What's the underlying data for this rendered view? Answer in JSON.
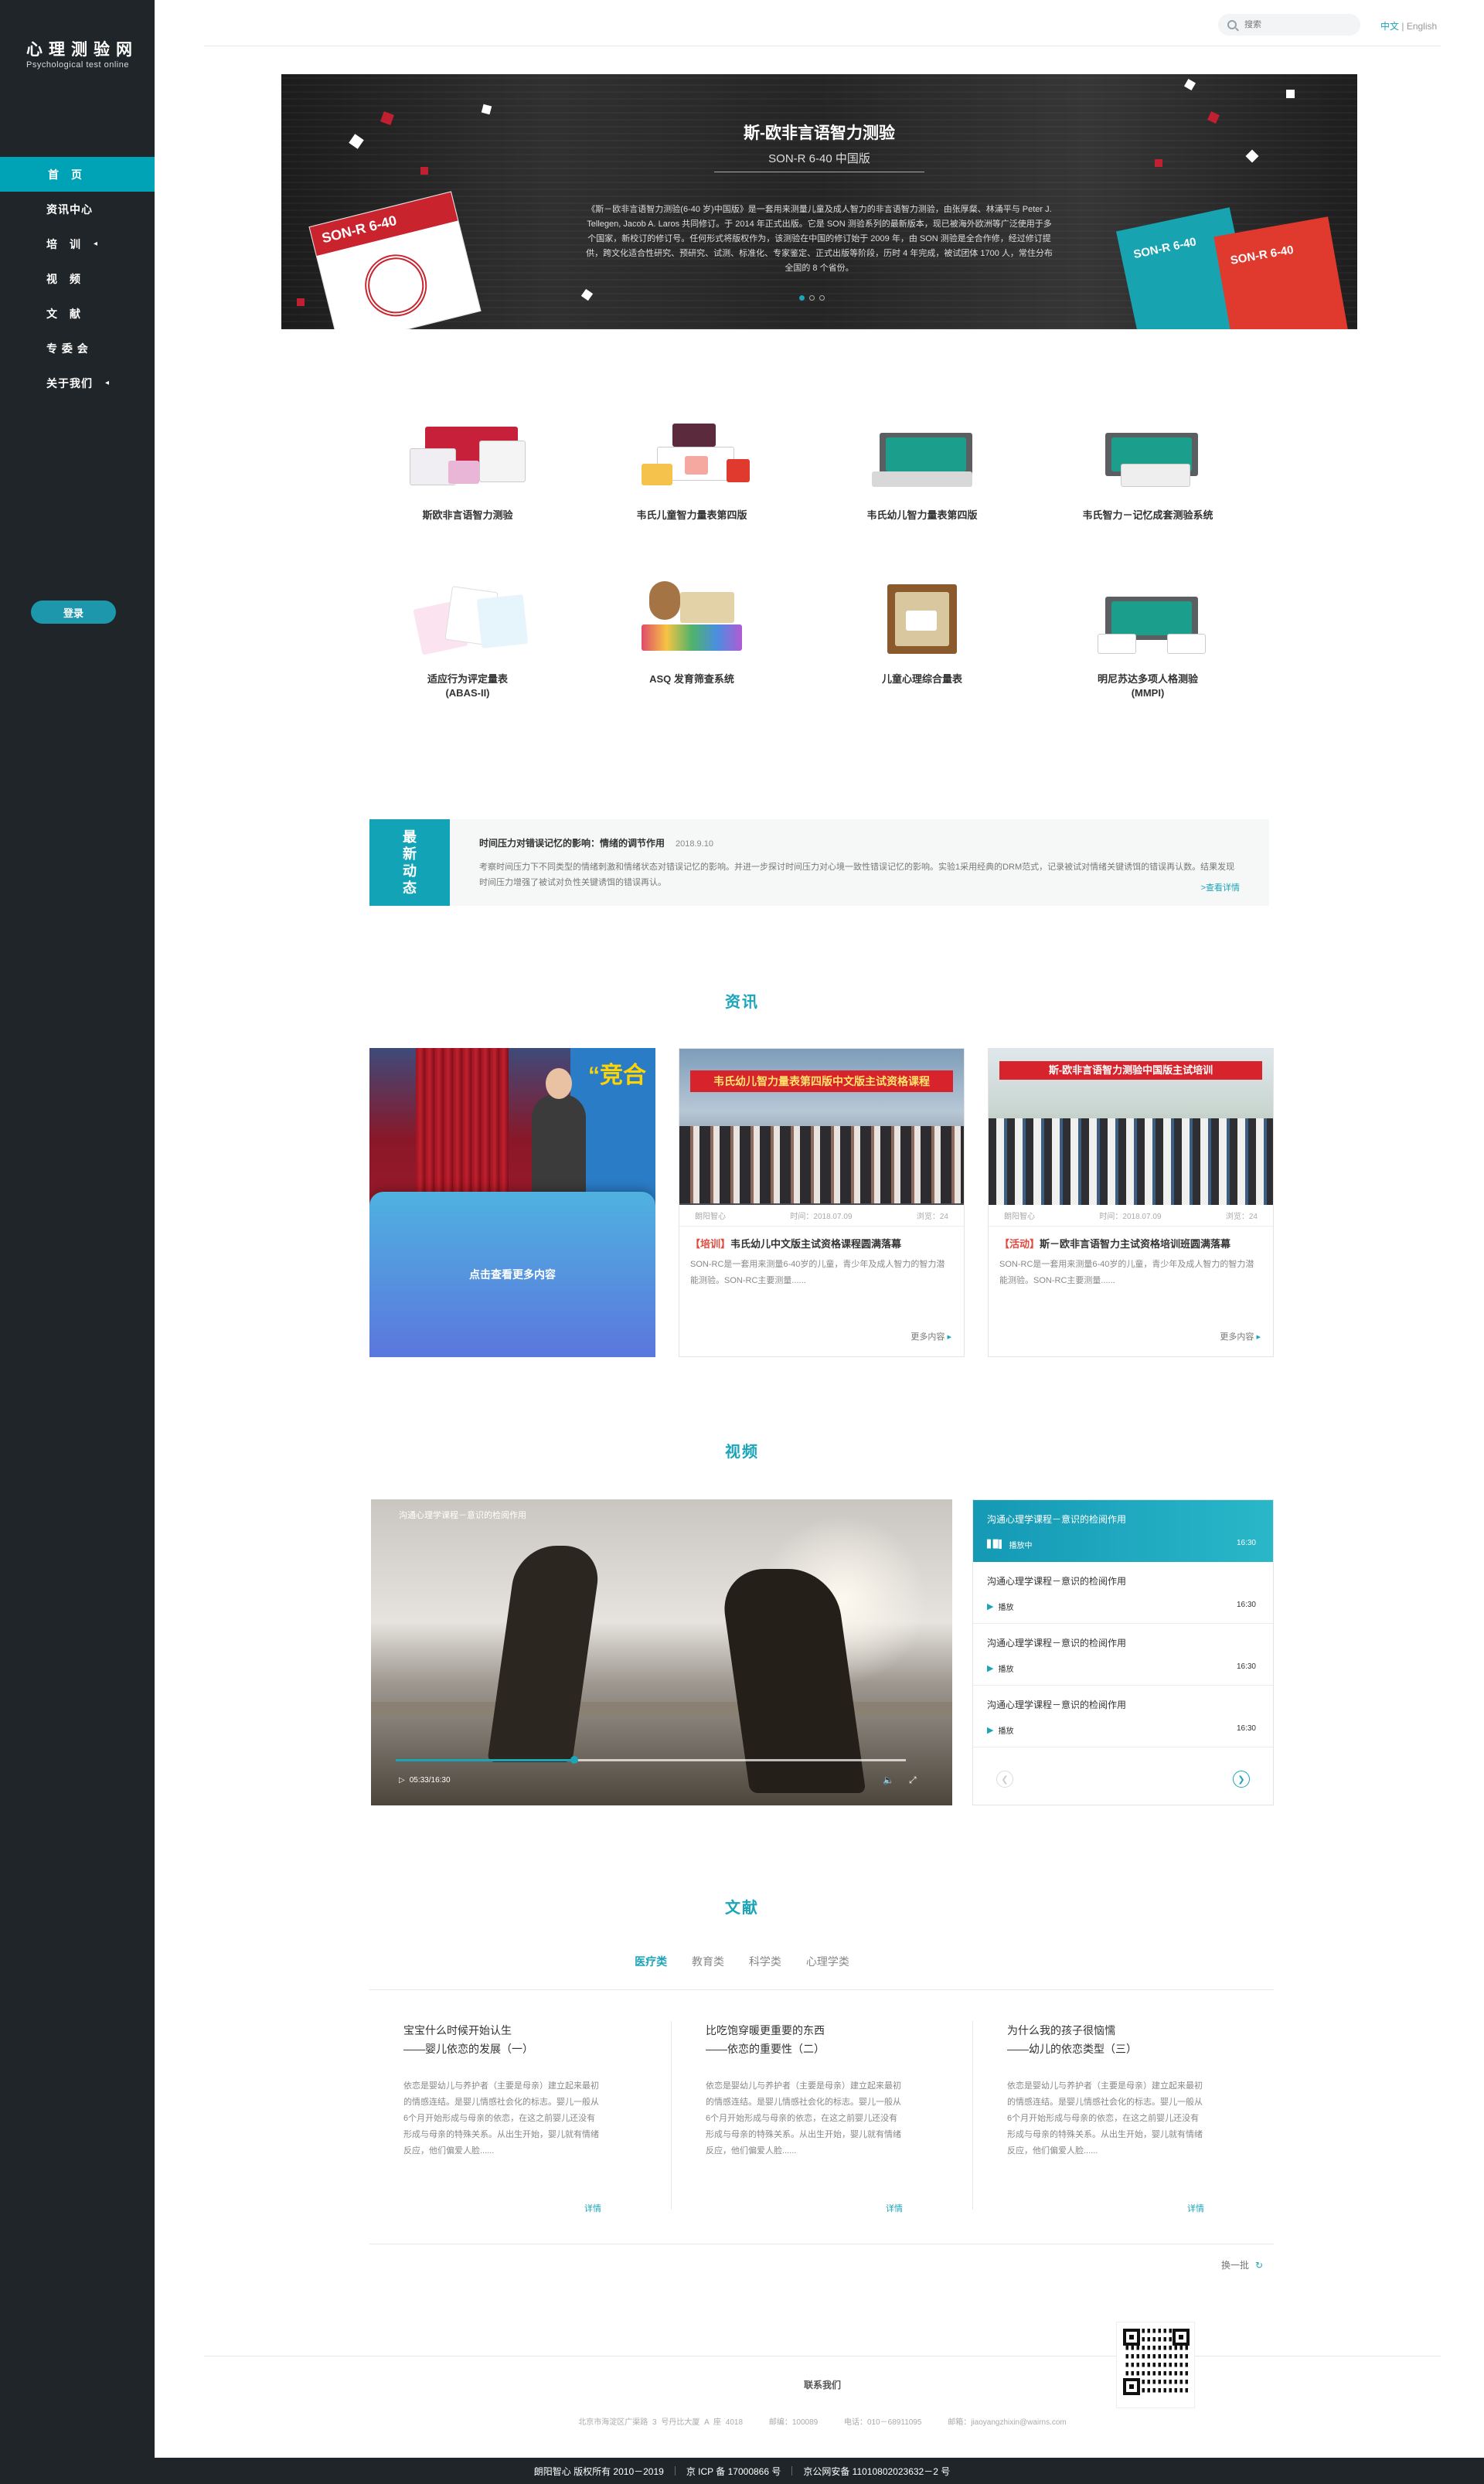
{
  "brand": {
    "title_cn": "心理测验网",
    "title_en": "Psychological test online"
  },
  "nav": {
    "items": [
      {
        "label": "首　页",
        "arrow": ""
      },
      {
        "label": "资讯中心",
        "arrow": ""
      },
      {
        "label": "培　训",
        "arrow": "◂"
      },
      {
        "label": "视　频",
        "arrow": ""
      },
      {
        "label": "文　献",
        "arrow": ""
      },
      {
        "label": "专 委 会",
        "arrow": ""
      },
      {
        "label": "关于我们",
        "arrow": "◂"
      }
    ],
    "login": "登录"
  },
  "header": {
    "search_placeholder": "搜索",
    "lang_cn": "中文",
    "lang_sep": " | ",
    "lang_en": "English"
  },
  "banner": {
    "title": "斯-欧非言语智力测验",
    "subtitle": "SON-R 6-40 中国版",
    "description": "《斯－欧非言语智力测验(6-40 岁)中国版》是一套用来测量儿童及成人智力的非言语智力测验，由张厚粲、林涌平与 Peter J. Tellegen, Jacob A. Laros 共同修订。于 2014 年正式出版。它是 SON 测验系列的最新版本，现已被海外欧洲等广泛使用于多个国家，新校订的修订号。任何形式将版权作为，该测验在中国的修订始于 2009 年，由 SON 测验是全合作修，经过修订提供，跨文化适合性研究、预研究、试测、标准化、专家鉴定、正式出版等阶段，历时 4 年完成，被试团体 1700 人，常住分布全国的 8 个省份。",
    "book_left": "SON-R 6-40",
    "book_right_1": "SON-R 6-40",
    "book_right_2": "SON-R 6-40"
  },
  "products": [
    {
      "name": "斯欧非言语智力测验",
      "name2": ""
    },
    {
      "name": "韦氏儿童智力量表第四版",
      "name2": ""
    },
    {
      "name": "韦氏幼儿智力量表第四版",
      "name2": ""
    },
    {
      "name": "韦氏智力－记忆成套测验系统",
      "name2": ""
    },
    {
      "name": "适应行为评定量表",
      "name2": "(ABAS-II)"
    },
    {
      "name": "ASQ 发育筛查系统",
      "name2": ""
    },
    {
      "name": "儿童心理综合量表",
      "name2": ""
    },
    {
      "name": "明尼苏达多项人格测验",
      "name2": "(MMPI)"
    }
  ],
  "latest": {
    "tag": [
      "最",
      "新",
      "动",
      "态"
    ],
    "title": "时间压力对错误记忆的影响：情绪的调节作用",
    "date": "2018.9.10",
    "body": "考察时间压力下不同类型的情绪刺激和情绪状态对错误记忆的影响。并进一步探讨时间压力对心境一致性错误记忆的影响。实验1采用经典的DRM范式，记录被试对情绪关键诱饵的错误再认数。结果发现时间压力增强了被试对负性关键诱饵的错误再认。",
    "more": ">查看详情"
  },
  "info": {
    "section_title": "资讯",
    "overlay": "点击查看更多内容",
    "first_deco": "“竞合",
    "cards": [
      {
        "banner_text": "韦氏幼儿智力量表第四版中文版主试资格课程",
        "source": "朗阳智心",
        "time": "时间：2018.07.09",
        "views": "浏览：24",
        "tag": "【培训】",
        "title": "韦氏幼儿中文版主试资格课程圆满落幕",
        "body": "SON-RC是一套用来测量6-40岁的儿童，青少年及成人智力的智力潜能测验。SON-RC主要测量......",
        "more": "更多内容"
      },
      {
        "banner_text": "斯-欧非言语智力测验中国版主试培训",
        "source": "朗阳智心",
        "time": "时间：2018.07.09",
        "views": "浏览：24",
        "tag": "【活动】",
        "title": "斯－欧非言语智力主试资格培训班圆满落幕",
        "body": "SON-RC是一套用来测量6-40岁的儿童，青少年及成人智力的智力潜能测验。SON-RC主要测量......",
        "more": "更多内容"
      }
    ]
  },
  "video": {
    "section_title": "视频",
    "title": "沟通心理学课程－意识的检阅作用",
    "time": "05:33/16:30",
    "progress": 0.35,
    "playlist": [
      {
        "title": "沟通心理学课程－意识的检阅作用",
        "status": "播放中",
        "time": "16:30",
        "active": true
      },
      {
        "title": "沟通心理学课程－意识的检阅作用",
        "status": "播放",
        "time": "16:30",
        "active": false
      },
      {
        "title": "沟通心理学课程－意识的检阅作用",
        "status": "播放",
        "time": "16:30",
        "active": false
      },
      {
        "title": "沟通心理学课程－意识的检阅作用",
        "status": "播放",
        "time": "16:30",
        "active": false
      }
    ]
  },
  "literature": {
    "section_title": "文献",
    "tabs": [
      "医疗类",
      "教育类",
      "科学类",
      "心理学类"
    ],
    "articles": [
      {
        "t1": "宝宝什么时候开始认生",
        "t2": "——婴儿依恋的发展（一）",
        "body": "依恋是婴幼儿与养护者（主要是母亲）建立起来最初的情感连结。是婴儿情感社会化的标志。婴儿一般从6个月开始形成与母亲的依恋，在这之前婴儿还没有形成与母亲的特殊关系。从出生开始，婴儿就有情绪反应，他们偏爱人脸......",
        "more": "详情"
      },
      {
        "t1": "比吃饱穿暖更重要的东西",
        "t2": "——依恋的重要性（二）",
        "body": "依恋是婴幼儿与养护者（主要是母亲）建立起来最初的情感连结。是婴儿情感社会化的标志。婴儿一般从6个月开始形成与母亲的依恋，在这之前婴儿还没有形成与母亲的特殊关系。从出生开始，婴儿就有情绪反应，他们偏爱人脸......",
        "more": "详情"
      },
      {
        "t1": "为什么我的孩子很恼懦",
        "t2": "——幼儿的依恋类型（三）",
        "body": "依恋是婴幼儿与养护者（主要是母亲）建立起来最初的情感连结。是婴儿情感社会化的标志。婴儿一般从6个月开始形成与母亲的依恋，在这之前婴儿还没有形成与母亲的特殊关系。从出生开始，婴儿就有情绪反应，他们偏爱人脸......",
        "more": "详情"
      }
    ],
    "refresh": "换一批"
  },
  "footer": {
    "contact_title": "联系我们",
    "address": "北京市海淀区广渠路 3 号丹比大厦 A 座 4018",
    "zip": "邮编：100089",
    "phone": "电话：010－68911095",
    "email": "邮箱：jiaoyangzhixin@wairns.com",
    "copyright": "朗阳智心 版权所有 2010－2019",
    "icp": "京 ICP 备 17000866 号",
    "police": "京公网安备 11010802023632－2 号"
  },
  "colors": {
    "accent": "#1ba5b9",
    "sidebar": "#1f2528"
  }
}
